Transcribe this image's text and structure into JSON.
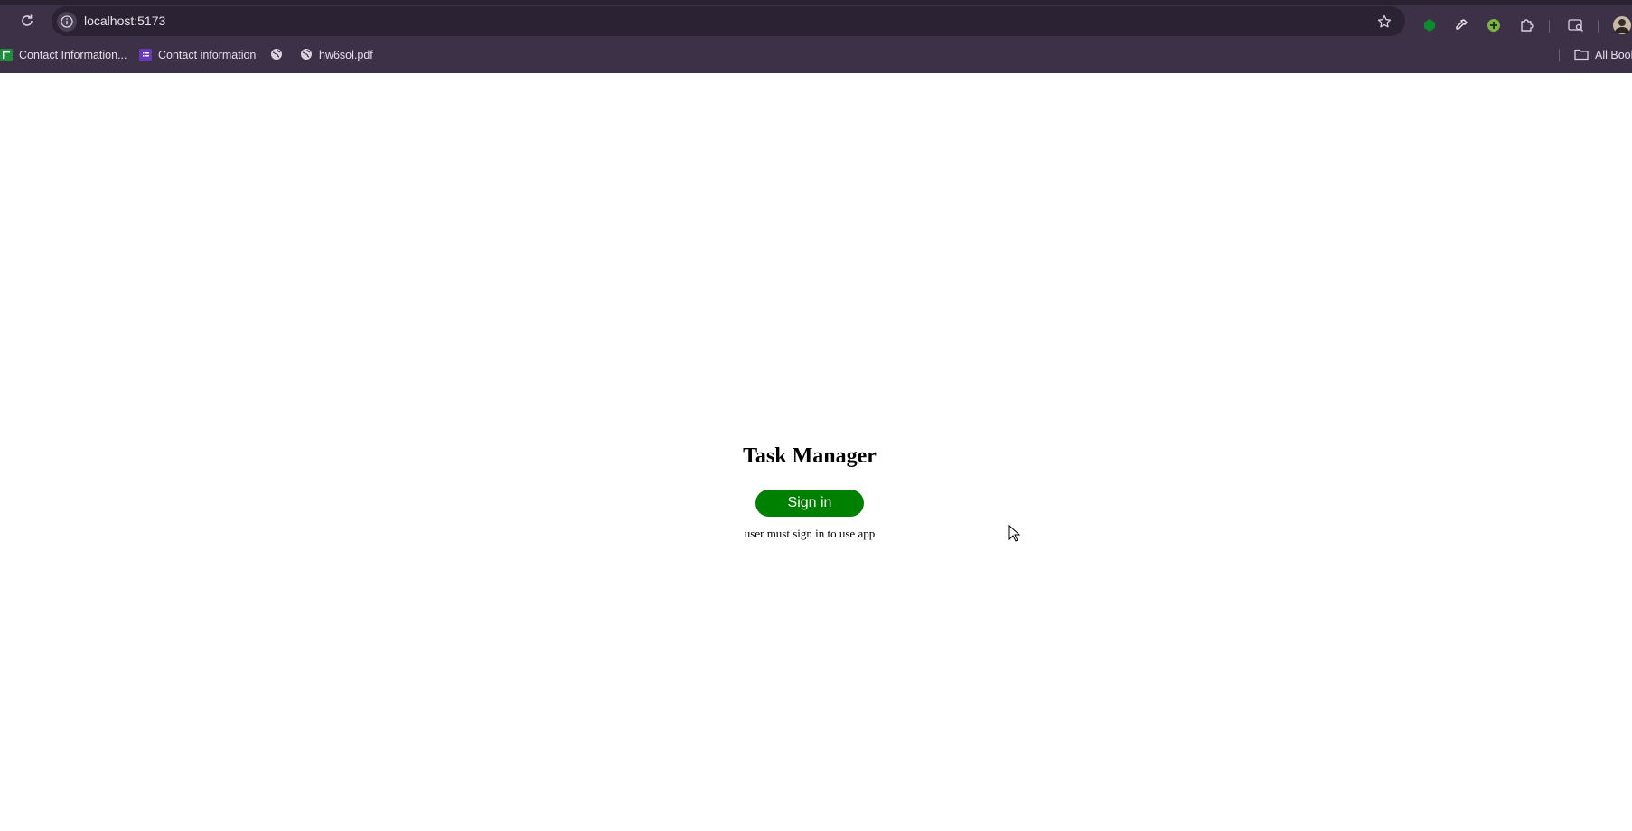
{
  "browser": {
    "url": "localhost:5173",
    "bookmarks": [
      {
        "label": "Contact Information...",
        "icon": "sheets-icon"
      },
      {
        "label": "Contact information",
        "icon": "forms-icon"
      },
      {
        "label": "",
        "icon": "globe-icon"
      },
      {
        "label": "hw6sol.pdf",
        "icon": "globe-icon"
      }
    ],
    "all_bookmarks_label": "All Bool"
  },
  "app": {
    "title": "Task Manager",
    "sign_in_label": "Sign in",
    "hint": "user must sign in to use app"
  },
  "colors": {
    "chrome_bg": "#3d3148",
    "omnibox_bg": "#2b2233",
    "sign_in_bg": "#008000"
  }
}
